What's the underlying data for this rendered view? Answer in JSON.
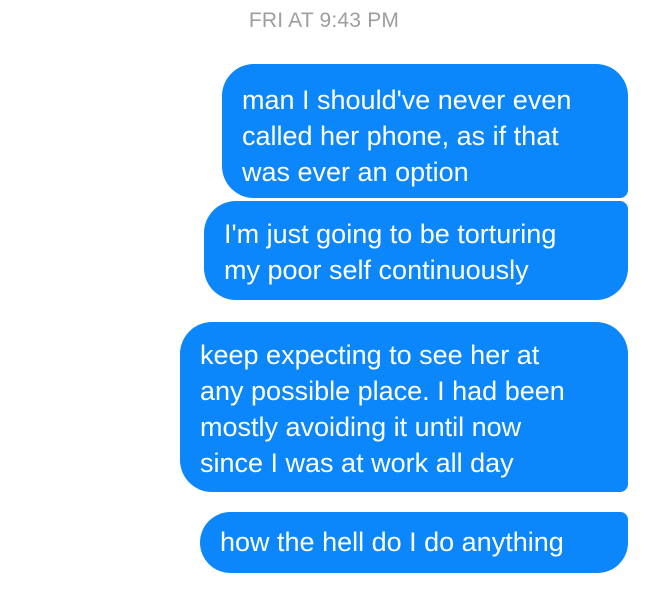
{
  "conversation": {
    "timestamp": "FRI AT 9:43 PM",
    "messages": [
      {
        "sender": "self",
        "lines": [
          "man I should've never even",
          "called her phone, as if that",
          "was ever an option"
        ]
      },
      {
        "sender": "self",
        "lines": [
          "I'm just going to be torturing",
          "my poor self continuously"
        ]
      },
      {
        "sender": "self",
        "lines": [
          "keep expecting to see her at",
          "any possible place. I had been",
          "mostly avoiding it until now",
          "since I was at work all day"
        ]
      },
      {
        "sender": "self",
        "lines": [
          "how the hell do I do anything"
        ]
      }
    ]
  },
  "colors": {
    "outgoing_bubble": "#0b86fb",
    "bubble_text": "#ffffff",
    "timestamp_text": "#9e9e9e",
    "background": "#ffffff"
  }
}
